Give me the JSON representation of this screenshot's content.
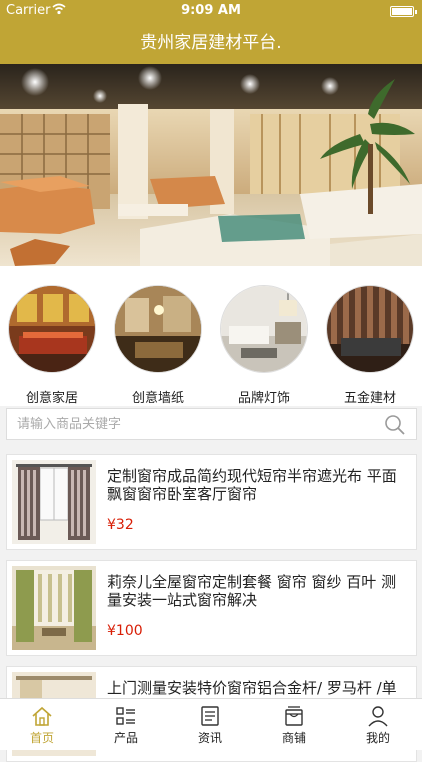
{
  "status_bar": {
    "carrier": "Carrier",
    "time": "9:09 AM"
  },
  "nav": {
    "title": "贵州家居建材平台."
  },
  "banner": {
    "slide_count": 2,
    "active_index": 0
  },
  "categories": [
    {
      "label": "创意家居",
      "image": "furniture-photo"
    },
    {
      "label": "创意墙纸",
      "image": "wallpaper-photo"
    },
    {
      "label": "品牌灯饰",
      "image": "lighting-photo"
    },
    {
      "label": "五金建材",
      "image": "hardware-photo"
    }
  ],
  "search": {
    "placeholder": "请输入商品关键字",
    "icon": "search-icon"
  },
  "products": [
    {
      "title": "定制窗帘成品简约现代短帘半帘遮光布 平面飘窗窗帘卧室客厅窗帘",
      "price": "¥32"
    },
    {
      "title": "莉奈儿全屋窗帘定制套餐 窗帘 窗纱 百叶 测量安装一站式窗帘解决",
      "price": "¥100"
    },
    {
      "title": "上门测量安装特价窗帘铝合金杆/ 罗马杆 /单",
      "price": ""
    }
  ],
  "tabs": [
    {
      "label": "首页",
      "icon": "home-icon",
      "active": true
    },
    {
      "label": "产品",
      "icon": "list-icon",
      "active": false
    },
    {
      "label": "资讯",
      "icon": "news-icon",
      "active": false
    },
    {
      "label": "商铺",
      "icon": "shop-icon",
      "active": false
    },
    {
      "label": "我的",
      "icon": "user-icon",
      "active": false
    }
  ],
  "colors": {
    "brand": "#c0a535",
    "price": "#d81e06",
    "dot_active": "#d0312d"
  }
}
